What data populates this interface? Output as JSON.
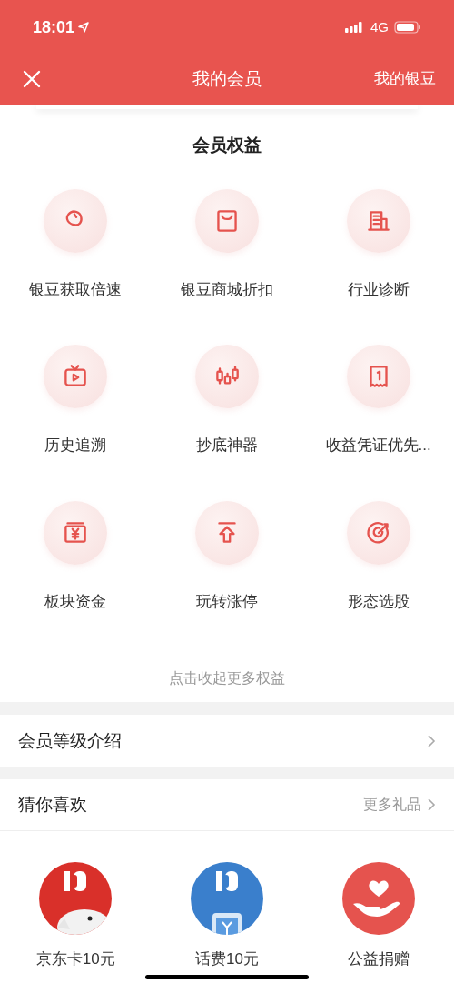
{
  "status_bar": {
    "time": "18:01",
    "network": "4G"
  },
  "nav": {
    "title": "我的会员",
    "right_link": "我的银豆"
  },
  "benefits": {
    "title": "会员权益",
    "items": [
      {
        "label": "银豆获取倍速"
      },
      {
        "label": "银豆商城折扣"
      },
      {
        "label": "行业诊断"
      },
      {
        "label": "历史追溯"
      },
      {
        "label": "抄底神器"
      },
      {
        "label": "收益凭证优先..."
      },
      {
        "label": "板块资金"
      },
      {
        "label": "玩转涨停"
      },
      {
        "label": "形态选股"
      }
    ],
    "collapse_link": "点击收起更多权益"
  },
  "level_intro": {
    "label": "会员等级介绍"
  },
  "recommend": {
    "title": "猜你喜欢",
    "more_link": "更多礼品",
    "gifts": [
      {
        "label": "京东卡10元",
        "kind": "picture",
        "color": "#d9302a"
      },
      {
        "label": "话费10元",
        "kind": "picture",
        "color": "#3a7fcc"
      },
      {
        "label": "公益捐赠",
        "kind": "icon",
        "color": "#e5534e"
      }
    ]
  }
}
